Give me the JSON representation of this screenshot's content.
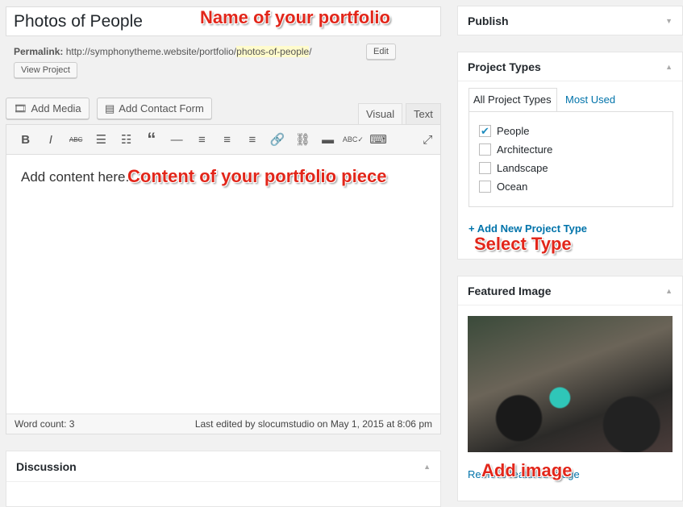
{
  "post": {
    "title": "Photos of People",
    "permalink_label": "Permalink:",
    "permalink_base": "http://symphonytheme.website/portfolio/",
    "permalink_slug": "photos-of-people",
    "permalink_trail": "/",
    "edit_label": "Edit",
    "view_label": "View Project"
  },
  "editor": {
    "add_media": "Add Media",
    "add_contact_form": "Add Contact Form",
    "tab_visual": "Visual",
    "tab_text": "Text",
    "content": "Add content here.",
    "word_count": "Word count: 3",
    "last_edited": "Last edited by slocumstudio on May 1, 2015 at 8:06 pm",
    "toolbar": [
      "bold-icon",
      "italic-icon",
      "strikethrough-icon",
      "bullet-list-icon",
      "numbered-list-icon",
      "blockquote-icon",
      "horizontal-rule-icon",
      "align-left-icon",
      "align-center-icon",
      "align-right-icon",
      "link-icon",
      "unlink-icon",
      "read-more-icon",
      "spellcheck-icon",
      "toolbar-toggle-icon",
      "fullscreen-icon"
    ]
  },
  "discussion": {
    "title": "Discussion"
  },
  "sidebar": {
    "publish": "Publish",
    "project_types": {
      "title": "Project Types",
      "tab_all": "All Project Types",
      "tab_most": "Most Used",
      "items": [
        {
          "label": "People",
          "checked": true
        },
        {
          "label": "Architecture",
          "checked": false
        },
        {
          "label": "Landscape",
          "checked": false
        },
        {
          "label": "Ocean",
          "checked": false
        }
      ],
      "add_new": "+ Add New Project Type"
    },
    "featured": {
      "title": "Featured Image",
      "remove": "Remove featured image"
    }
  },
  "annotations": {
    "name": "Name of your portfolio",
    "content": "Content of your portfolio piece",
    "type": "Select Type",
    "image": "Add image"
  },
  "colors": {
    "annotation": "#e2261a",
    "link": "#0073aa",
    "checkbox": "#1e8cbe"
  }
}
